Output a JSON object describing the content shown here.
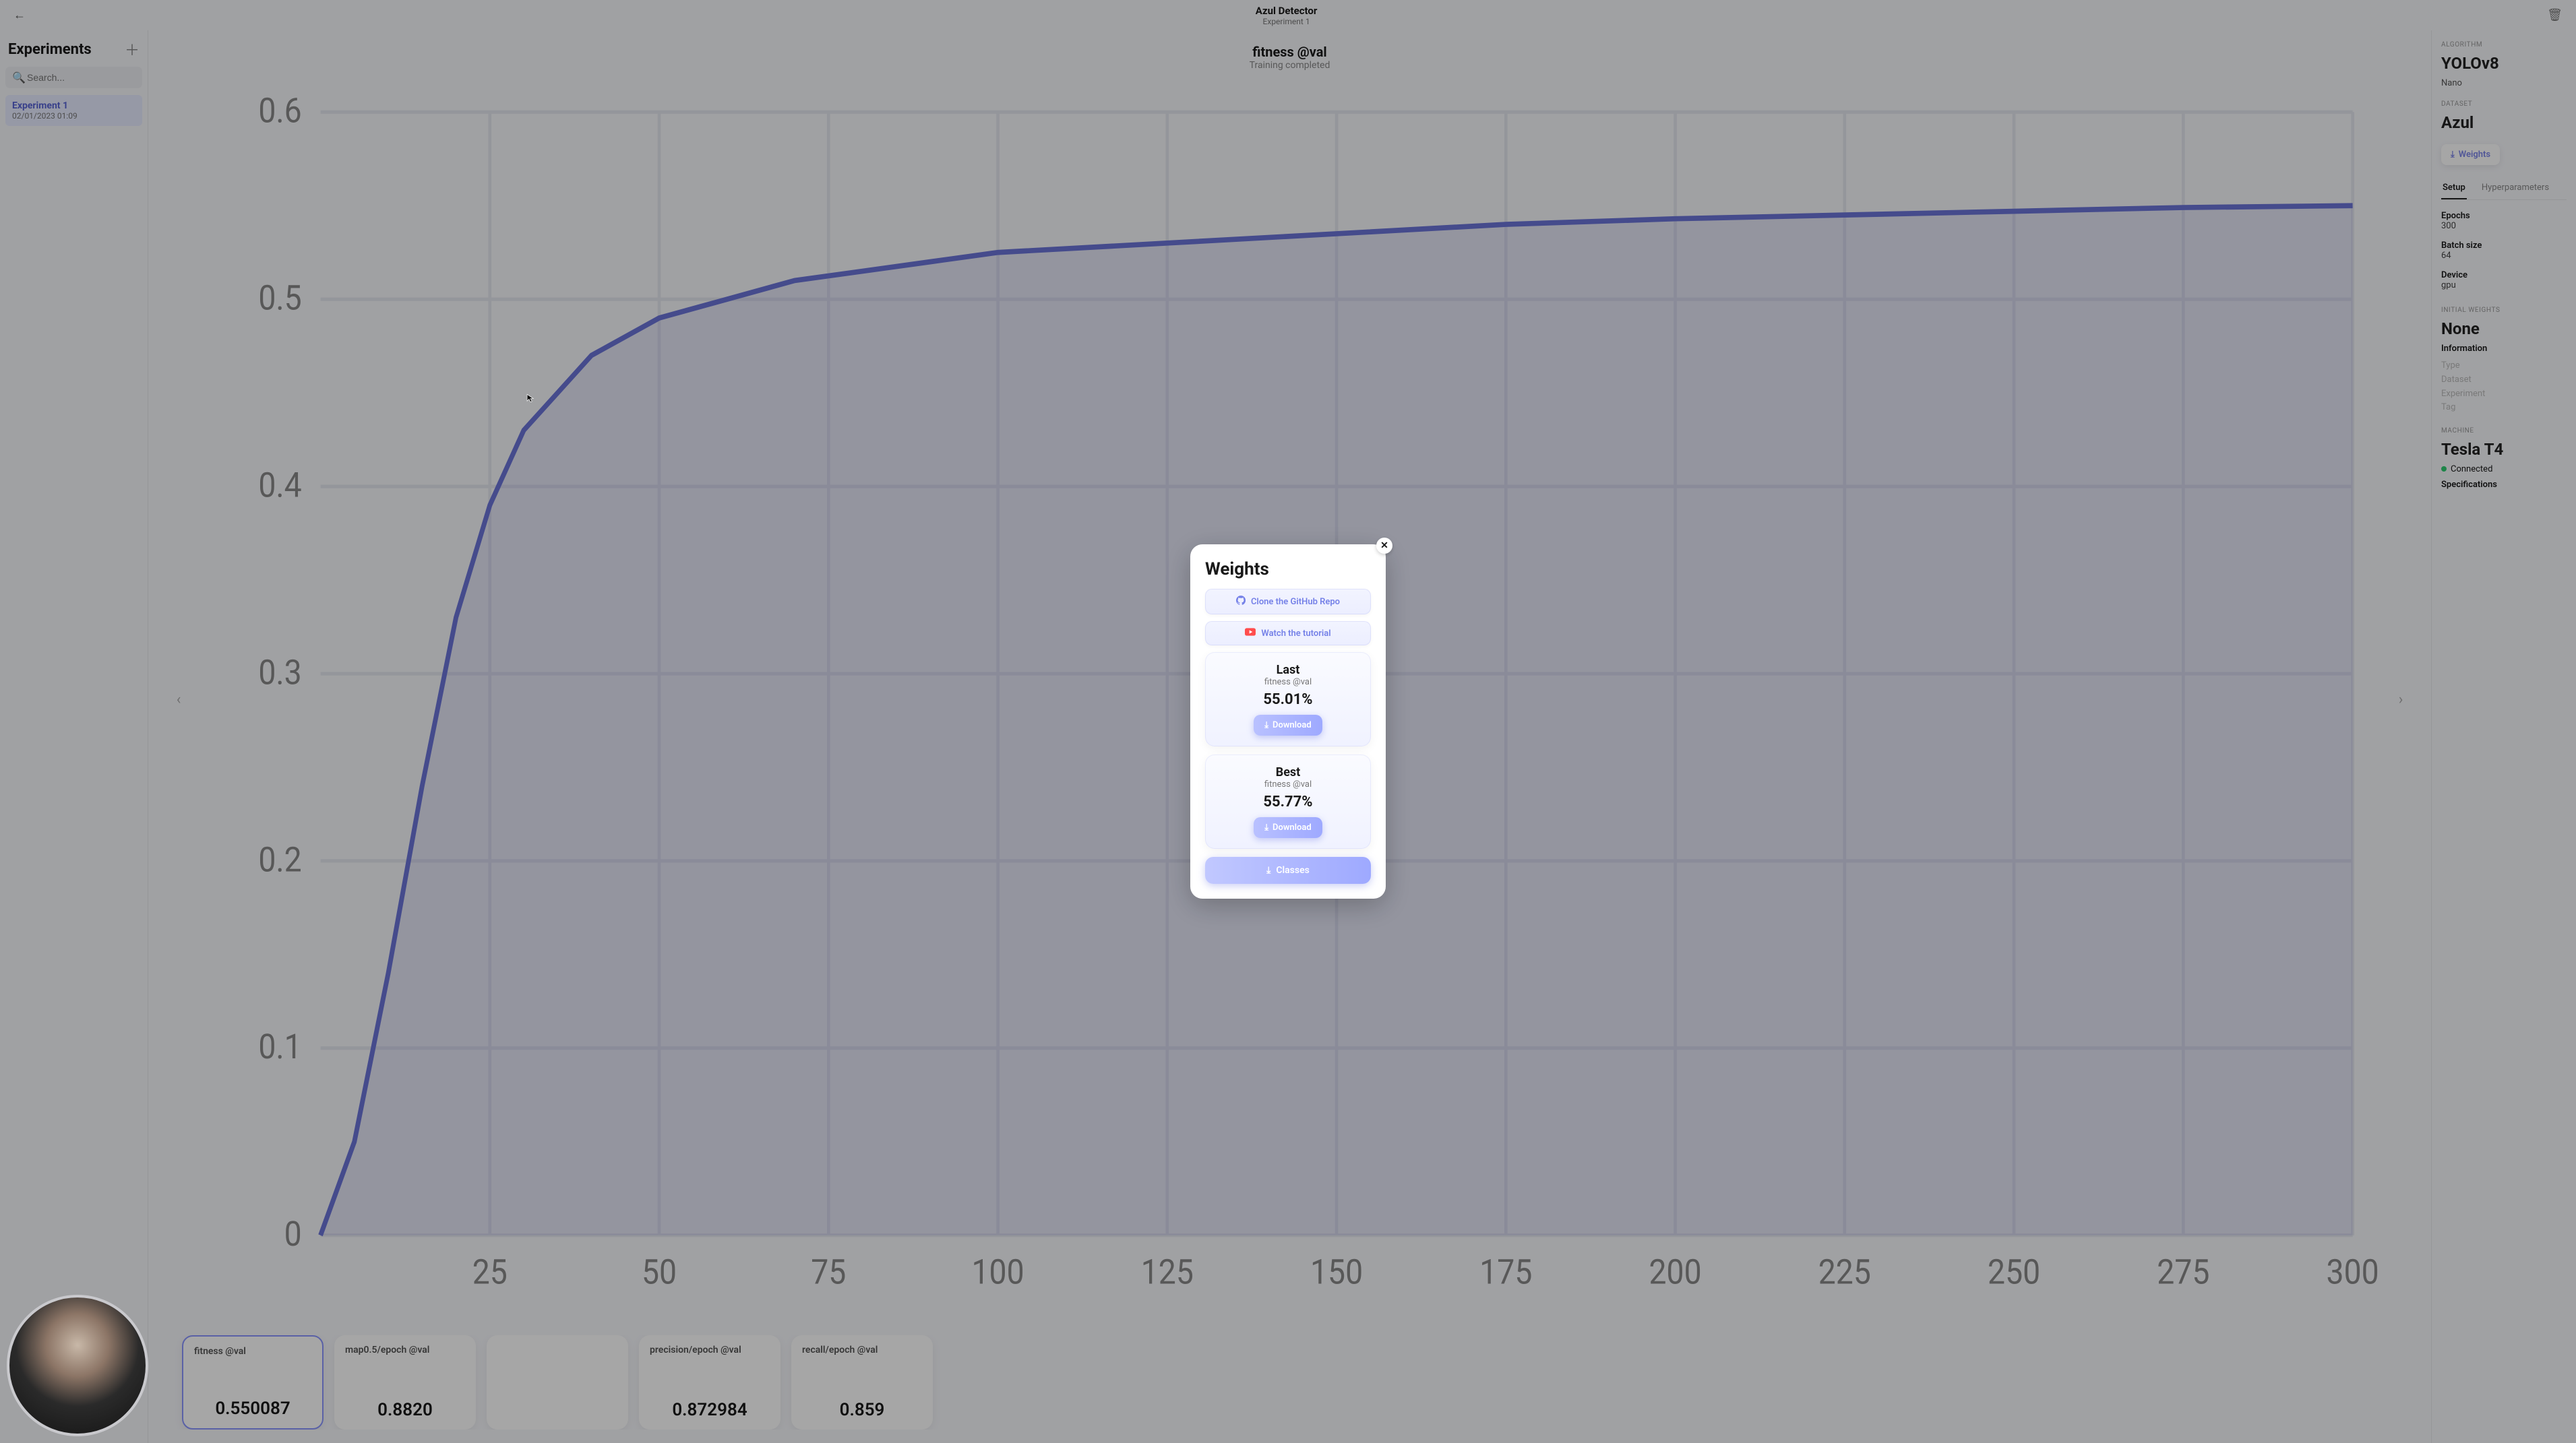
{
  "header": {
    "title": "Azul Detector",
    "subtitle": "Experiment 1"
  },
  "sidebar": {
    "title": "Experiments",
    "search_placeholder": "Search...",
    "experiments": [
      {
        "name": "Experiment 1",
        "date": "02/01/2023 01:09"
      }
    ]
  },
  "main": {
    "chart_title": "fitness @val",
    "chart_status": "Training completed",
    "metrics": [
      {
        "label": "fitness @val",
        "value": "0.550087"
      },
      {
        "label": "map0.5/epoch @val",
        "value": "0.8820"
      },
      {
        "label": "",
        "value": ""
      },
      {
        "label": "precision/epoch @val",
        "value": "0.872984"
      },
      {
        "label": "recall/epoch @val",
        "value": "0.859"
      }
    ]
  },
  "rpanel": {
    "algorithm_label": "ALGORITHM",
    "algorithm": "YOLOv8",
    "algorithm_sub": "Nano",
    "dataset_label": "DATASET",
    "dataset": "Azul",
    "weights_button": "Weights",
    "tabs": {
      "setup": "Setup",
      "hyper": "Hyperparameters"
    },
    "kv": {
      "epochs_k": "Epochs",
      "epochs_v": "300",
      "batch_k": "Batch size",
      "batch_v": "64",
      "device_k": "Device",
      "device_v": "gpu"
    },
    "init_weights_label": "INITIAL WEIGHTS",
    "init_weights": "None",
    "info_heading": "Information",
    "info_fields": {
      "type": "Type",
      "dataset": "Dataset",
      "experiment": "Experiment",
      "tag": "Tag"
    },
    "machine_label": "MACHINE",
    "machine": "Tesla T4",
    "connected": "Connected",
    "specs": "Specifications"
  },
  "modal": {
    "title": "Weights",
    "github": "Clone the GitHub Repo",
    "tutorial": "Watch the tutorial",
    "last": {
      "title": "Last",
      "metric": "fitness @val",
      "value": "55.01%",
      "download": "Download"
    },
    "best": {
      "title": "Best",
      "metric": "fitness @val",
      "value": "55.77%",
      "download": "Download"
    },
    "classes": "Classes"
  },
  "colors": {
    "accent": "#7b84e8",
    "accent_gradient_start": "#b9c1ff",
    "accent_gradient_end": "#9ea9ff"
  },
  "chart_data": {
    "type": "line",
    "title": "fitness @val",
    "xlabel": "",
    "ylabel": "",
    "xlim": [
      0,
      300
    ],
    "ylim": [
      0,
      0.6
    ],
    "x_ticks": [
      25,
      50,
      75,
      100,
      125,
      150,
      175,
      200,
      225,
      250,
      275,
      300
    ],
    "y_ticks": [
      0,
      0.1,
      0.2,
      0.3,
      0.4,
      0.5,
      0.6
    ],
    "x": [
      0,
      5,
      10,
      15,
      20,
      25,
      30,
      35,
      40,
      45,
      50,
      60,
      70,
      80,
      90,
      100,
      125,
      150,
      175,
      200,
      225,
      250,
      275,
      300
    ],
    "y": [
      0.0,
      0.05,
      0.14,
      0.24,
      0.33,
      0.39,
      0.43,
      0.45,
      0.47,
      0.48,
      0.49,
      0.5,
      0.51,
      0.515,
      0.52,
      0.525,
      0.53,
      0.535,
      0.54,
      0.543,
      0.545,
      0.547,
      0.549,
      0.55
    ]
  }
}
